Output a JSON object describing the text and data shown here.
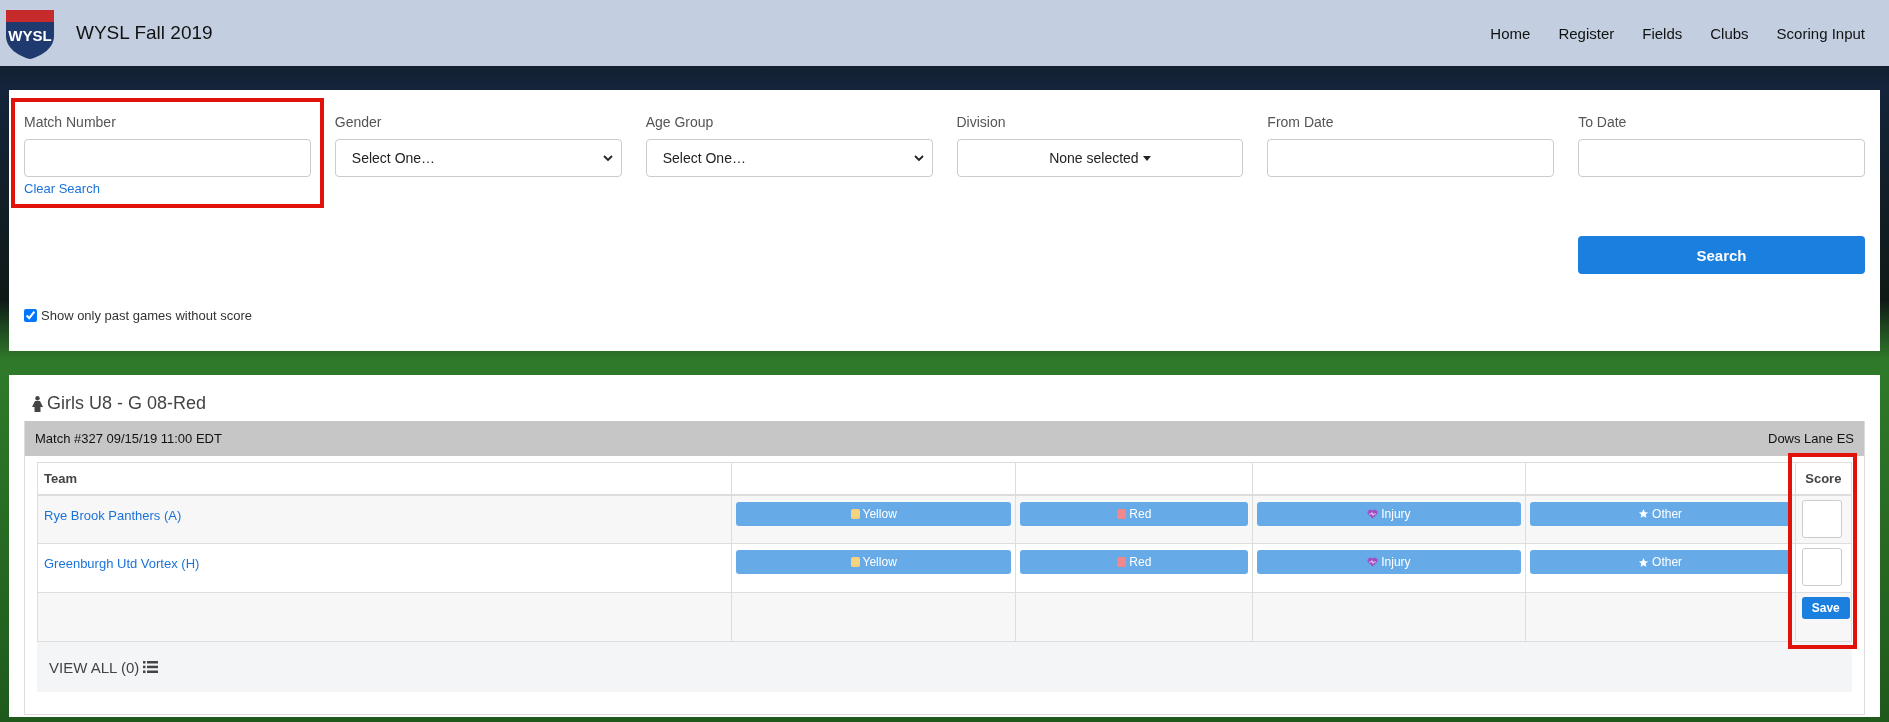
{
  "header": {
    "title": "WYSL Fall 2019",
    "logo_text": "WYSL",
    "nav": [
      "Home",
      "Register",
      "Fields",
      "Clubs",
      "Scoring Input"
    ]
  },
  "filters": {
    "fields": [
      {
        "kind": "text",
        "label": "Match Number",
        "highlighted": true,
        "link": "Clear Search"
      },
      {
        "kind": "select",
        "label": "Gender",
        "value": "Select One…"
      },
      {
        "kind": "select",
        "label": "Age Group",
        "value": "Select One…"
      },
      {
        "kind": "multiselect",
        "label": "Division",
        "value": "None selected"
      },
      {
        "kind": "text",
        "label": "From Date"
      },
      {
        "kind": "text",
        "label": "To Date"
      }
    ],
    "search_button": "Search",
    "past_only": {
      "label": "Show only past games without score",
      "checked": true
    }
  },
  "results": {
    "title": "Girls U8 - G 08-Red",
    "match": {
      "info": "Match #327 09/15/19 11:00 EDT",
      "location": "Dows Lane ES"
    },
    "columns": [
      "Team",
      "Score"
    ],
    "score_highlighted": true,
    "rows": [
      {
        "team": "Rye Brook Panthers (A)",
        "actions": [
          {
            "kind": "yellow",
            "label": "Yellow"
          },
          {
            "kind": "red",
            "label": "Red"
          },
          {
            "kind": "injury",
            "label": "Injury"
          },
          {
            "kind": "other",
            "label": "Other"
          }
        ]
      },
      {
        "team": "Greenburgh Utd Vortex (H)",
        "actions": [
          {
            "kind": "yellow",
            "label": "Yellow"
          },
          {
            "kind": "red",
            "label": "Red"
          },
          {
            "kind": "injury",
            "label": "Injury"
          },
          {
            "kind": "other",
            "label": "Other"
          }
        ]
      }
    ],
    "save_button": "Save",
    "view_all": "VIEW ALL (0)"
  }
}
